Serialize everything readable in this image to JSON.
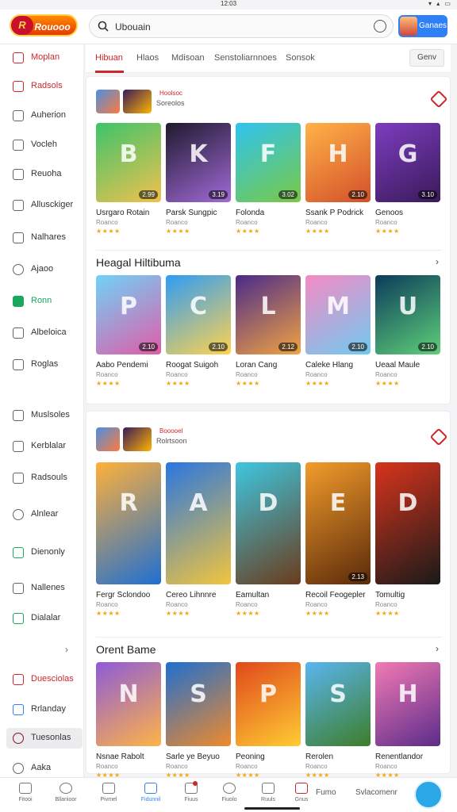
{
  "status": {
    "time": "12:03",
    "icons": "▾ ▴ ▭"
  },
  "header": {
    "logo": "Rouooo",
    "logo_mark": "R",
    "search_value": "Ubouain",
    "account_label": "Ganaes"
  },
  "sidebar": {
    "items": [
      {
        "label": "Moplan",
        "icon": "home-icon"
      },
      {
        "label": "Radsols",
        "icon": "games-icon"
      },
      {
        "label": "Auherion",
        "icon": "controller-icon"
      },
      {
        "label": "Vocleh",
        "icon": "video-icon"
      },
      {
        "label": "Reuoha",
        "icon": "folder-icon"
      },
      {
        "label": "Allusckiger",
        "icon": "calendar-icon"
      },
      {
        "label": "Nalhares",
        "icon": "gamepad-icon"
      },
      {
        "label": "Ajaoo",
        "icon": "clock-icon"
      },
      {
        "label": "Ronn",
        "icon": "store-icon"
      },
      {
        "label": "Albeloica",
        "icon": "square-icon"
      },
      {
        "label": "Roglas",
        "icon": "puzzle-icon"
      },
      {
        "label": "Muslsoles",
        "icon": "hand-icon"
      },
      {
        "label": "Kerblalar",
        "icon": "cross-icon"
      },
      {
        "label": "Radsouls",
        "icon": "book-icon"
      },
      {
        "label": "Alnlear",
        "icon": "chat-icon"
      },
      {
        "label": "Dienonly",
        "icon": "green-icon"
      },
      {
        "label": "Nallenes",
        "icon": "bag-icon"
      },
      {
        "label": "Dialalar",
        "icon": "news-icon"
      },
      {
        "label": "Duesciolas",
        "icon": "ticket-icon"
      },
      {
        "label": "Rrlanday",
        "icon": "user-icon"
      },
      {
        "label": "Tuesonlas",
        "icon": "star-icon"
      },
      {
        "label": "Aaka",
        "icon": "help-icon"
      }
    ],
    "chevron": "›"
  },
  "tabs": {
    "items": [
      "Hibuan",
      "Hlaos",
      "Mdisoan",
      "Senstoliarnnoes",
      "Sonsok"
    ],
    "action": "Genv"
  },
  "panel1": {
    "head_title": "Hoolsoc",
    "head_sub": "Soreolos",
    "cards": [
      {
        "title": "Usrgaro Rotain",
        "sub": "Roanco",
        "stars": "★★★★",
        "size": "2.99",
        "glyph": "B",
        "bg": "linear-gradient(150deg,#3cc46a,#f2c14e)"
      },
      {
        "title": "Parsk Sungpic",
        "sub": "Roanco",
        "stars": "★★★★",
        "size": "3.19",
        "glyph": "K",
        "bg": "linear-gradient(150deg,#1e1a2e,#a26ad8)"
      },
      {
        "title": "Folonda",
        "sub": "Roanco",
        "stars": "★★★★",
        "size": "3.02",
        "glyph": "F",
        "bg": "linear-gradient(150deg,#2ec3f0,#7ac943)"
      },
      {
        "title": "Ssank P Podrick",
        "sub": "Roanco",
        "stars": "★★★★",
        "size": "2.10",
        "glyph": "H",
        "bg": "linear-gradient(150deg,#ffb347,#d44f2b)"
      },
      {
        "title": "Genoos",
        "sub": "Roanco",
        "stars": "★★★★",
        "size": "3.10",
        "glyph": "G",
        "bg": "linear-gradient(150deg,#7c3dbf,#3a1a5a)"
      }
    ],
    "section_title": "Heagal Hiltibuma",
    "section_arrow": "›",
    "cards2": [
      {
        "title": "Aabo Pendemi",
        "sub": "Roanco",
        "stars": "★★★★",
        "size": "2.10",
        "glyph": "P",
        "bg": "linear-gradient(150deg,#6fd3f7,#e05ca8)"
      },
      {
        "title": "Roogat Suigoh",
        "sub": "Roanco",
        "stars": "★★★★",
        "size": "2.10",
        "glyph": "C",
        "bg": "linear-gradient(150deg,#2f9cf5,#ffd34e)"
      },
      {
        "title": "Loran Cang",
        "sub": "Roanco",
        "stars": "★★★★",
        "size": "2.12",
        "glyph": "L",
        "bg": "linear-gradient(150deg,#4a2a8a,#f2a341)"
      },
      {
        "title": "Caleke Hlang",
        "sub": "Roanco",
        "stars": "★★★★",
        "size": "2.10",
        "glyph": "M",
        "bg": "linear-gradient(150deg,#f58ac4,#6fcaf0)"
      },
      {
        "title": "Ueaal Maule",
        "sub": "Roanco",
        "stars": "★★★★",
        "size": "2.10",
        "glyph": "U",
        "bg": "linear-gradient(150deg,#0b3b5a,#5fd07a)"
      }
    ]
  },
  "panel2": {
    "head_title": "Booooel",
    "head_sub": "Rolrtsoon",
    "cards": [
      {
        "title": "Fergr Sclondoo",
        "sub": "Roanco",
        "stars": "★★★★",
        "size": "",
        "glyph": "R",
        "bg": "linear-gradient(150deg,#ffb03a,#1f6fd1)"
      },
      {
        "title": "Cereo Lihnnre",
        "sub": "Roanco",
        "stars": "★★★★",
        "size": "",
        "glyph": "A",
        "bg": "linear-gradient(150deg,#2a76e0,#f2c53d)"
      },
      {
        "title": "Eamultan",
        "sub": "Roanco",
        "stars": "★★★★",
        "size": "",
        "glyph": "D",
        "bg": "linear-gradient(150deg,#3ec6e0,#6a3c1c)"
      },
      {
        "title": "Recoil Feogepler",
        "sub": "Roanco",
        "stars": "★★★★",
        "size": "2.13",
        "glyph": "E",
        "bg": "linear-gradient(150deg,#f39c2b,#5a2a0a)"
      },
      {
        "title": "Tomultig",
        "sub": "Roanco",
        "stars": "★★★★",
        "size": "",
        "glyph": "D",
        "bg": "linear-gradient(150deg,#d8341c,#1a1a1a)"
      }
    ],
    "section_title": "Orent Bame",
    "section_arrow": "›",
    "cards2": [
      {
        "title": "Nsnae Rabolt",
        "sub": "Roanco",
        "stars": "★★★★",
        "size": "",
        "glyph": "N",
        "bg": "linear-gradient(150deg,#8e5bd8,#ffb347)"
      },
      {
        "title": "Sarle ye Beyuo",
        "sub": "Roanco",
        "stars": "★★★★",
        "size": "",
        "glyph": "S",
        "bg": "linear-gradient(150deg,#1e6fd0,#f08a2b)"
      },
      {
        "title": "Peoning",
        "sub": "Roanco",
        "stars": "★★★★",
        "size": "",
        "glyph": "P",
        "bg": "linear-gradient(150deg,#e0481c,#ffcc33)"
      },
      {
        "title": "Rerolen",
        "sub": "Roanco",
        "stars": "★★★★",
        "size": "",
        "glyph": "S",
        "bg": "linear-gradient(150deg,#59b6f0,#3e7d2a)"
      },
      {
        "title": "Renentlandor",
        "sub": "Roanco",
        "stars": "★★★★",
        "size": "",
        "glyph": "H",
        "bg": "linear-gradient(150deg,#f27ab4,#5b2c8a)"
      }
    ]
  },
  "bottomnav": {
    "items": [
      {
        "label": "Fitooi",
        "icon": "grid-icon"
      },
      {
        "label": "Bllariioor",
        "icon": "compass-icon"
      },
      {
        "label": "Pivmel",
        "icon": "shield-icon"
      },
      {
        "label": "Fidunnil",
        "icon": "people-icon"
      },
      {
        "label": "Fiuus",
        "icon": "bell-icon"
      },
      {
        "label": "Fiuolo",
        "icon": "circle-icon"
      },
      {
        "label": "Ruuls",
        "icon": "lock-icon"
      },
      {
        "label": "Gnus",
        "icon": "chart-icon"
      }
    ],
    "text1": "Fumo",
    "text2": "Svlacomenr"
  },
  "colors": {
    "accent": "#d0262a",
    "primary": "#2f7ff7",
    "star": "#f3a712"
  }
}
